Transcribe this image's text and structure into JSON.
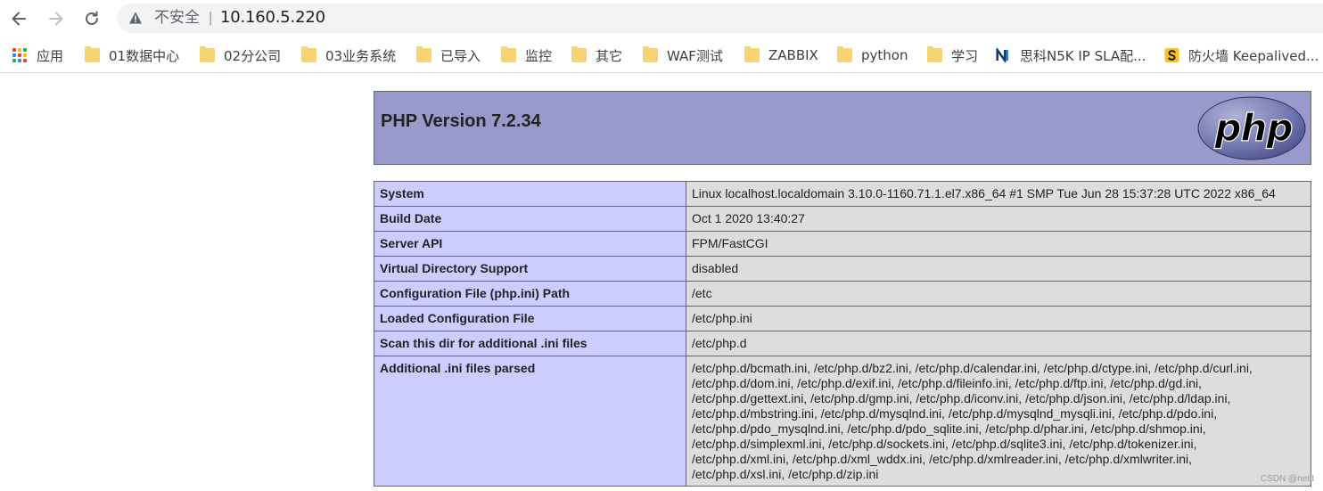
{
  "browser": {
    "security_label": "不安全",
    "separator": "|",
    "url": "10.160.5.220"
  },
  "bookmarks": [
    {
      "label": "应用",
      "icon": "apps-grid-icon"
    },
    {
      "label": "01数据中心",
      "icon": "folder-icon"
    },
    {
      "label": "02分公司",
      "icon": "folder-icon"
    },
    {
      "label": "03业务系统",
      "icon": "folder-icon"
    },
    {
      "label": "已导入",
      "icon": "folder-icon"
    },
    {
      "label": "监控",
      "icon": "folder-icon"
    },
    {
      "label": "其它",
      "icon": "folder-icon"
    },
    {
      "label": "WAF测试",
      "icon": "folder-icon"
    },
    {
      "label": "ZABBIX",
      "icon": "folder-icon"
    },
    {
      "label": "python",
      "icon": "folder-icon"
    },
    {
      "label": "学习",
      "icon": "folder-icon"
    },
    {
      "label": "思科N5K IP SLA配...",
      "icon": "n-site-icon"
    },
    {
      "label": "防火墙 Keepalived...",
      "icon": "s-site-icon"
    }
  ],
  "php": {
    "title": "PHP Version 7.2.34",
    "logo_text": "php",
    "rows": [
      {
        "key": "System",
        "value": "Linux localhost.localdomain 3.10.0-1160.71.1.el7.x86_64 #1 SMP Tue Jun 28 15:37:28 UTC 2022 x86_64"
      },
      {
        "key": "Build Date",
        "value": "Oct 1 2020 13:40:27"
      },
      {
        "key": "Server API",
        "value": "FPM/FastCGI"
      },
      {
        "key": "Virtual Directory Support",
        "value": "disabled"
      },
      {
        "key": "Configuration File (php.ini) Path",
        "value": "/etc"
      },
      {
        "key": "Loaded Configuration File",
        "value": "/etc/php.ini"
      },
      {
        "key": "Scan this dir for additional .ini files",
        "value": "/etc/php.d"
      },
      {
        "key": "Additional .ini files parsed",
        "value": "/etc/php.d/bcmath.ini, /etc/php.d/bz2.ini, /etc/php.d/calendar.ini, /etc/php.d/ctype.ini, /etc/php.d/curl.ini,\n/etc/php.d/dom.ini, /etc/php.d/exif.ini, /etc/php.d/fileinfo.ini, /etc/php.d/ftp.ini, /etc/php.d/gd.ini,\n/etc/php.d/gettext.ini, /etc/php.d/gmp.ini, /etc/php.d/iconv.ini, /etc/php.d/json.ini, /etc/php.d/ldap.ini,\n/etc/php.d/mbstring.ini, /etc/php.d/mysqlnd.ini, /etc/php.d/mysqlnd_mysqli.ini, /etc/php.d/pdo.ini,\n/etc/php.d/pdo_mysqlnd.ini, /etc/php.d/pdo_sqlite.ini, /etc/php.d/phar.ini, /etc/php.d/shmop.ini,\n/etc/php.d/simplexml.ini, /etc/php.d/sockets.ini, /etc/php.d/sqlite3.ini, /etc/php.d/tokenizer.ini,\n/etc/php.d/xml.ini, /etc/php.d/xml_wddx.ini, /etc/php.d/xmlreader.ini, /etc/php.d/xmlwriter.ini,\n/etc/php.d/xsl.ini, /etc/php.d/zip.ini"
      }
    ]
  },
  "watermark": "CSDN @netit",
  "colors": {
    "header_bg": "#9999cc",
    "key_bg": "#ccccff",
    "value_bg": "#dddddd",
    "folder": "#f6d473",
    "omnibox_bg": "#f1f3f4"
  }
}
